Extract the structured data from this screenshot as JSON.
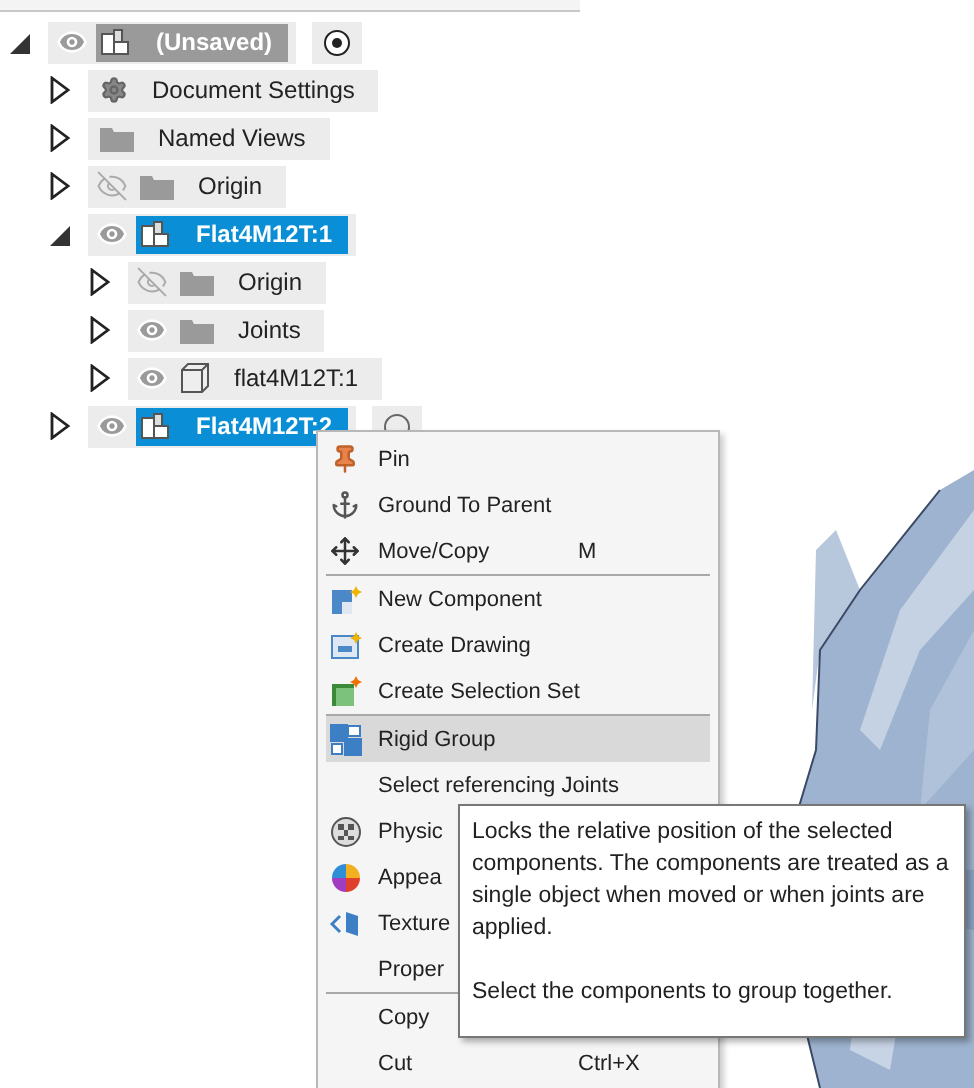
{
  "browser": {
    "root": {
      "label": "(Unsaved)",
      "kind": "component",
      "visible": true,
      "active": true,
      "activated": true,
      "expanded": true,
      "children": [
        {
          "label": "Document Settings",
          "kind": "settings",
          "active": false,
          "selected": false,
          "expanded": false
        },
        {
          "label": "Named Views",
          "kind": "folder",
          "active": false,
          "selected": false,
          "expanded": false
        },
        {
          "label": "Origin",
          "kind": "folder",
          "visible": false,
          "active": false,
          "selected": false,
          "expanded": false
        },
        {
          "label": "Flat4M12T:1",
          "kind": "component",
          "visible": true,
          "active": false,
          "selected": true,
          "expanded": true,
          "children": [
            {
              "label": "Origin",
              "kind": "folder",
              "visible": false,
              "active": false,
              "selected": false,
              "expanded": false
            },
            {
              "label": "Joints",
              "kind": "folder",
              "visible": true,
              "active": false,
              "selected": false,
              "expanded": false
            },
            {
              "label": "flat4M12T:1",
              "kind": "body",
              "visible": true,
              "active": false,
              "selected": false,
              "expanded": false
            }
          ]
        },
        {
          "label": "Flat4M12T:2",
          "kind": "component",
          "visible": true,
          "active": false,
          "selected": true,
          "activated": false,
          "expanded": false
        }
      ]
    }
  },
  "context_menu": [
    {
      "kind": "item",
      "label": "Pin",
      "highlighted": false
    },
    {
      "kind": "item",
      "label": "Ground To Parent",
      "highlighted": false
    },
    {
      "kind": "item",
      "label": "Move/Copy",
      "shortcut": "M",
      "highlighted": false
    },
    {
      "kind": "separator"
    },
    {
      "kind": "item",
      "label": "New Component",
      "highlighted": false
    },
    {
      "kind": "item",
      "label": "Create Drawing",
      "highlighted": false
    },
    {
      "kind": "item",
      "label": "Create Selection Set",
      "highlighted": false
    },
    {
      "kind": "separator"
    },
    {
      "kind": "item",
      "label": "Rigid Group",
      "highlighted": true
    },
    {
      "kind": "item",
      "label": "Select referencing Joints",
      "highlighted": false
    },
    {
      "kind": "item",
      "label": "Physic",
      "highlighted": false
    },
    {
      "kind": "item",
      "label": "Appea",
      "highlighted": false
    },
    {
      "kind": "item",
      "label": "Texture",
      "highlighted": false
    },
    {
      "kind": "item",
      "label": "Proper",
      "highlighted": false
    },
    {
      "kind": "separator"
    },
    {
      "kind": "item",
      "label": "Copy",
      "highlighted": false
    },
    {
      "kind": "item",
      "label": "Cut",
      "shortcut": "Ctrl+X",
      "highlighted": false
    }
  ],
  "tooltip": {
    "paragraphs": [
      "Locks the relative position of the selected components. The components are treated as a single object when moved or when joints are applied.",
      "Select the components to group together."
    ]
  }
}
